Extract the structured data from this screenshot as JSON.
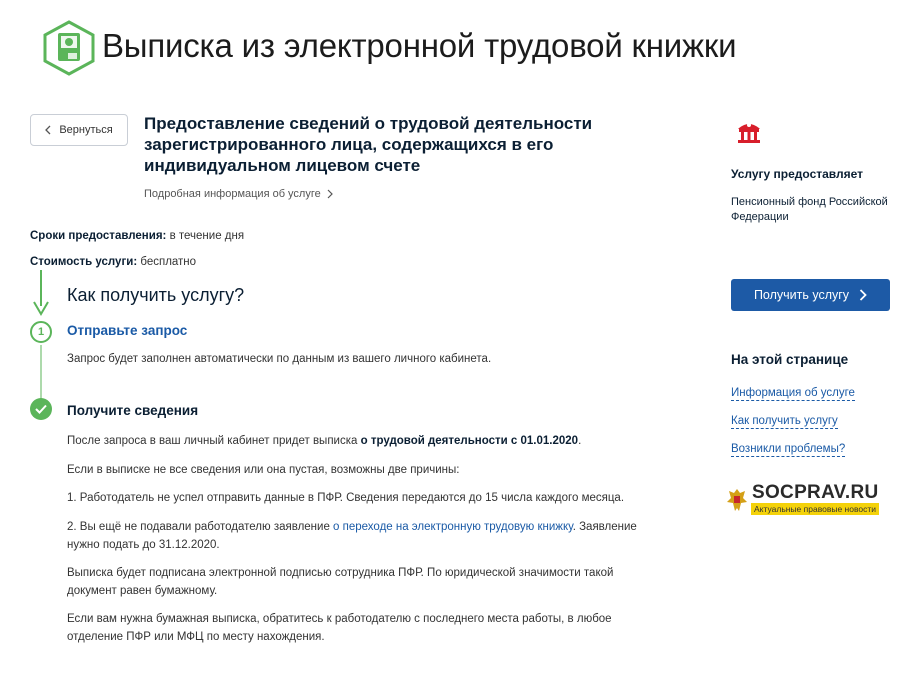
{
  "header": {
    "title": "Выписка из электронной трудовой книжки"
  },
  "back_button": {
    "label": "Вернуться"
  },
  "service": {
    "title": "Предоставление сведений о трудовой деятельности зарегистрированного лица, содержащихся в его индивидуальном лицевом счете",
    "details_link": "Подробная информация об услуге"
  },
  "meta": {
    "terms_label": "Сроки предоставления:",
    "terms_value": "в течение дня",
    "cost_label": "Стоимость услуги:",
    "cost_value": "бесплатно"
  },
  "how": {
    "title": "Как получить услугу?",
    "step1": {
      "number": "1",
      "title": "Отправьте запрос",
      "text": "Запрос будет заполнен автоматически по данным из вашего личного кабинета."
    },
    "step2": {
      "title": "Получите сведения",
      "p1_a": "После запроса в ваш личный кабинет придет выписка",
      "p1_b": "о трудовой деятельности с 01.01.2020",
      "p1_c": ".",
      "p2": "Если в выписке не все сведения или она пустая, возможны две причины:",
      "p3": "1. Работодатель не успел отправить данные в ПФР. Сведения передаются до 15 числа каждого месяца.",
      "p4_a": "2. Вы ещё не подавали работодателю заявление",
      "p4_link": "о переходе на электронную трудовую книжку",
      "p4_b": ". Заявление нужно подать до 31.12.2020.",
      "p5": "Выписка будет подписана электронной подписью сотрудника ПФР. По юридической значимости такой документ равен бумажному.",
      "p6": "Если вам нужна бумажная выписка, обратитесь к работодателю с последнего места работы, в любое отделение ПФР или МФЦ по месту нахождения."
    }
  },
  "sidebar": {
    "provider_label": "Услугу предоставляет",
    "provider_name": "Пенсионный фонд Российской Федерации",
    "get_button": "Получить услугу",
    "toc_title": "На этой странице",
    "toc_items": [
      "Информация об услуге",
      "Как получить услугу",
      "Возникли проблемы?"
    ]
  },
  "watermark": {
    "name": "SOCPRAV.RU",
    "tagline": "Актуальные правовые новости"
  },
  "colors": {
    "accent_green": "#5bb55a",
    "primary_blue": "#1d5aa6",
    "link_blue": "#1a5aa6",
    "watermark_yellow": "#f4d20a"
  }
}
